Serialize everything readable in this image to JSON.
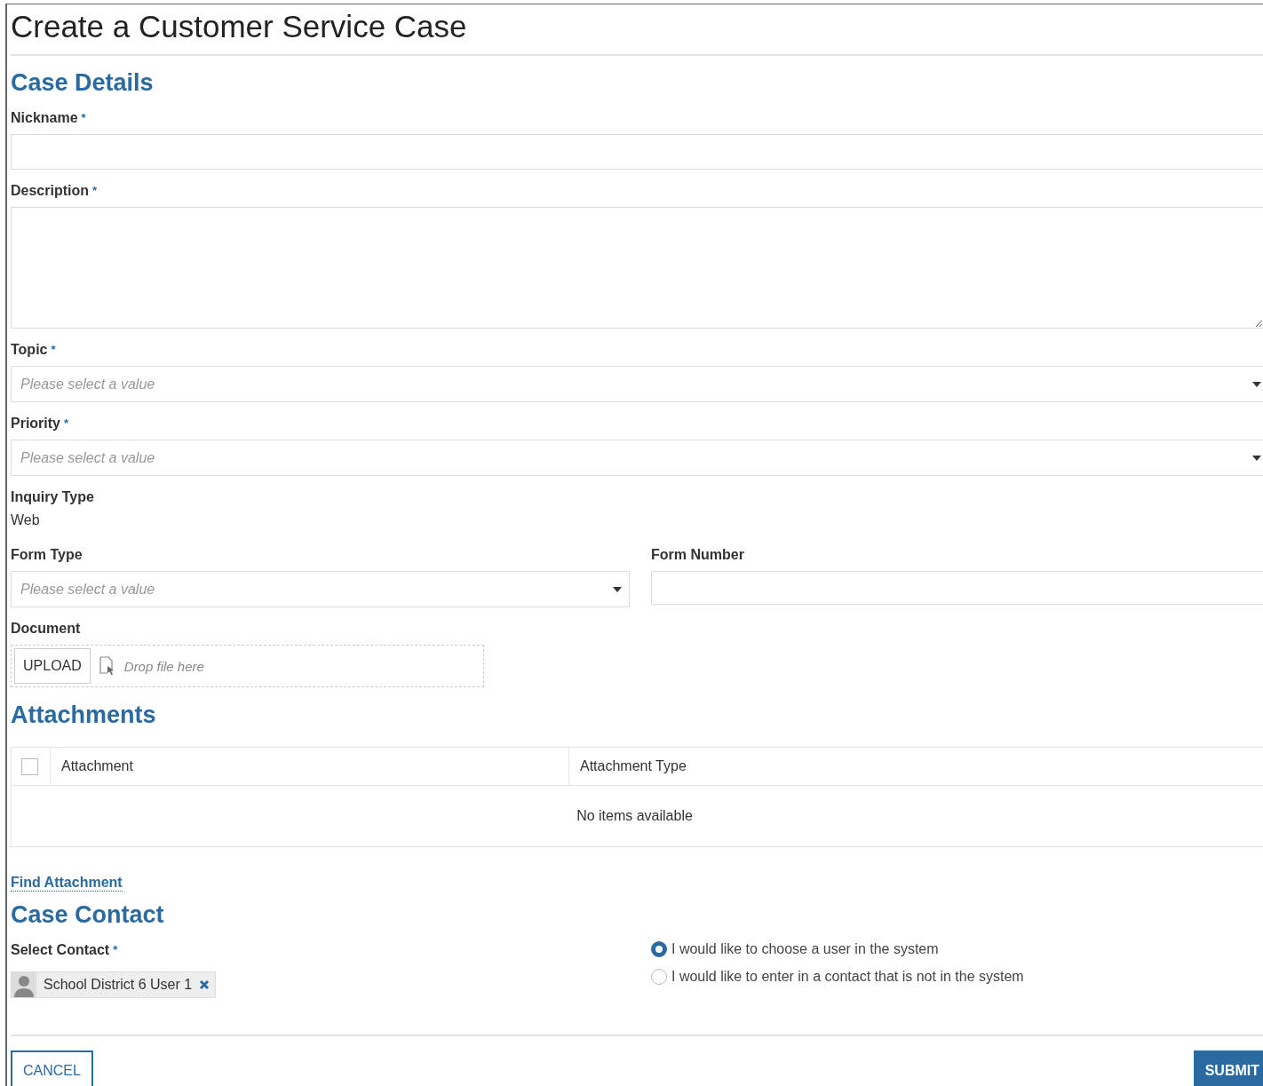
{
  "page": {
    "title": "Create a Customer Service Case"
  },
  "case_details": {
    "heading": "Case Details",
    "fields": [
      {
        "kind": "text",
        "label": "Nickname",
        "mark": "*"
      },
      {
        "kind": "textarea",
        "label": "Description",
        "mark": "*"
      },
      {
        "kind": "select",
        "label": "Topic",
        "mark": "*",
        "placeholder": "Please select a value"
      },
      {
        "kind": "select",
        "label": "Priority",
        "mark": "*",
        "placeholder": "Please select a value"
      },
      {
        "kind": "static",
        "label": "Inquiry Type",
        "value": "Web"
      }
    ],
    "form_type": {
      "label": "Form Type",
      "placeholder": "Please select a value"
    },
    "form_number": {
      "label": "Form Number"
    },
    "document": {
      "label": "Document",
      "upload_button": "UPLOAD",
      "drop_hint": "Drop file here"
    }
  },
  "attachments": {
    "heading": "Attachments",
    "select_all": {
      "checked": false
    },
    "columns": [
      "Attachment",
      "Attachment Type"
    ],
    "empty_message": "No items available",
    "link": "Find Attachment"
  },
  "case_contact": {
    "heading": "Case Contact",
    "label": "Select Contact",
    "mark": "*",
    "contact": "School District 6 User 1",
    "options": [
      {
        "label": "I would like to choose a user in the system",
        "selected": true
      },
      {
        "label": "I would like to enter in a contact that is not in the system",
        "selected": false
      }
    ]
  },
  "buttons": {
    "cancel": "CANCEL",
    "submit": "SUBMIT"
  }
}
